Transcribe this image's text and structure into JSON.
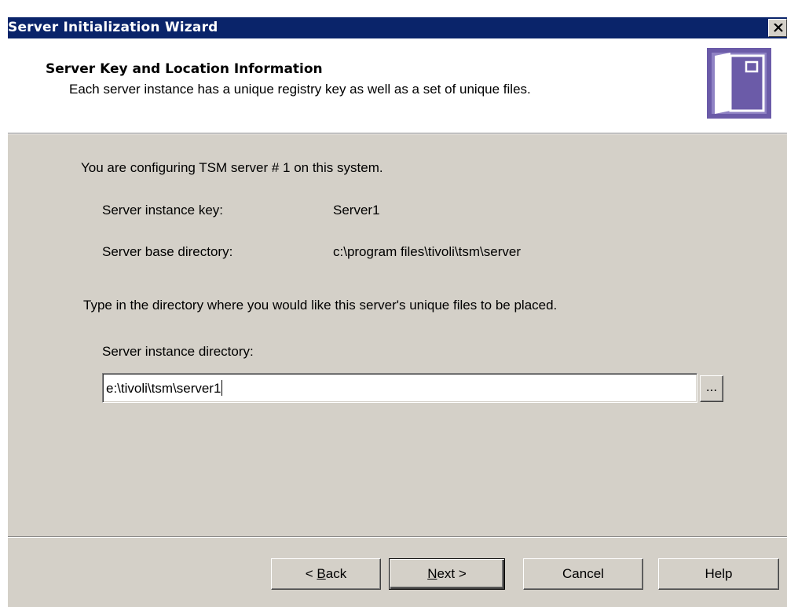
{
  "window": {
    "title": "Server Initialization Wizard",
    "close_icon": "close-icon"
  },
  "header": {
    "title": "Server Key and Location Information",
    "subtitle": "Each server instance has a unique registry key as well as a set of unique files.",
    "icon": "server-window-icon"
  },
  "content": {
    "intro": "You are configuring TSM server # 1 on this system.",
    "instance_key_label": "Server instance key:",
    "instance_key_value": "Server1",
    "base_dir_label": "Server base directory:",
    "base_dir_value": "c:\\program files\\tivoli\\tsm\\server",
    "instruction": "Type in the directory where you would like this server's unique files to be placed.",
    "instance_dir_label": "Server instance directory:",
    "instance_dir_value": "e:\\tivoli\\tsm\\server1",
    "browse_label": "..."
  },
  "buttons": {
    "back": {
      "prefix": "< ",
      "mnemonic": "B",
      "rest": "ack"
    },
    "next": {
      "mnemonic": "N",
      "rest": "ext >"
    },
    "cancel": "Cancel",
    "help": "Help"
  },
  "colors": {
    "titlebar": "#0a246a",
    "dialog_face": "#d4d0c8",
    "icon_purple": "#6b5ba8"
  }
}
